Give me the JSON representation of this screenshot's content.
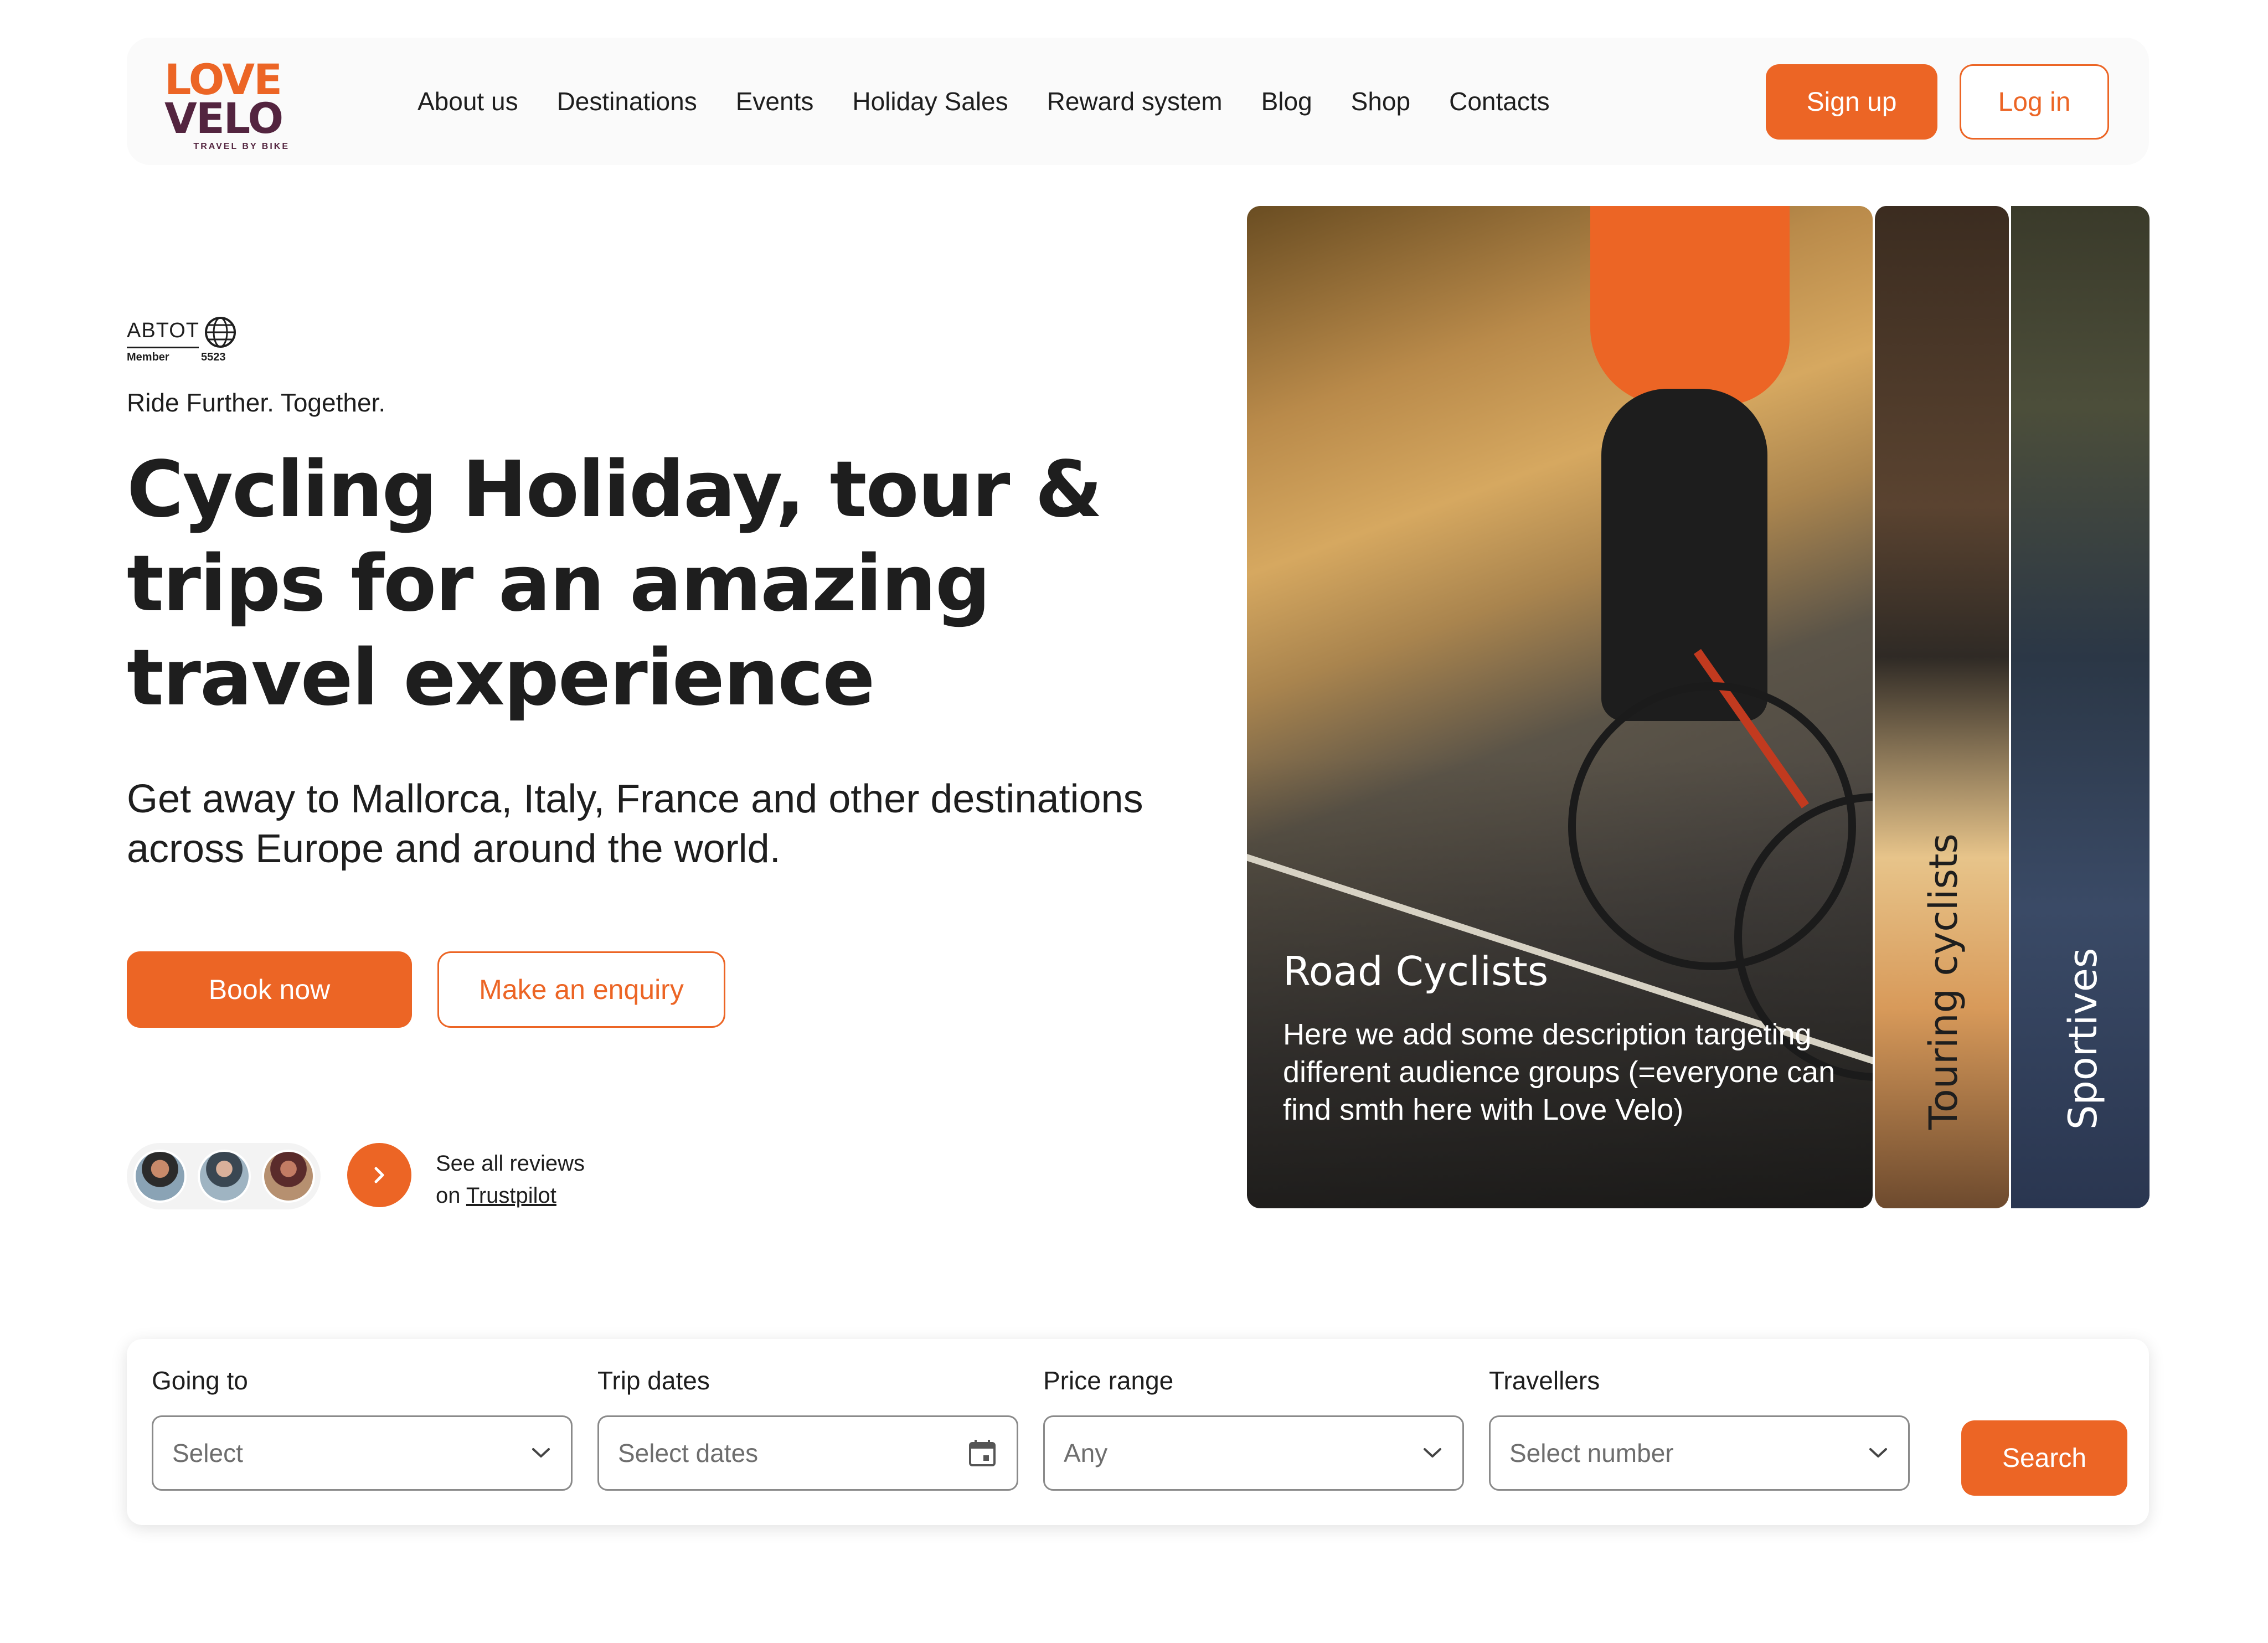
{
  "brand": {
    "logo_word1": "LOVE",
    "logo_word2": "VELO",
    "logo_tagline": "TRAVEL BY BIKE",
    "accent_color": "#ec6525",
    "brand_dark": "#53243f"
  },
  "nav": {
    "items": [
      "About us",
      "Destinations",
      "Events",
      "Holiday Sales",
      "Reward system",
      "Blog",
      "Shop",
      "Contacts"
    ],
    "signup_label": "Sign up",
    "login_label": "Log in"
  },
  "hero": {
    "badge": {
      "name": "ABTOT",
      "member_label": "Member",
      "member_number": "5523"
    },
    "tagline": "Ride Further. Together.",
    "title": "Cycling Holiday, tour & trips for an amazing travel experience",
    "subtitle": "Get away to Mallorca, Italy, France and other destinations across Europe and around the world.",
    "book_label": "Book now",
    "enquiry_label": "Make an enquiry",
    "reviews_line1": "See all reviews",
    "reviews_on": "on ",
    "reviews_link": "Trustpilot"
  },
  "cards": {
    "main_title": "Road Cyclists",
    "main_desc": "Here we add some description targeting different audience groups (=everyone can find smth here with Love Velo)",
    "touring_label": "Touring cyclists",
    "sportives_label": "Sportives"
  },
  "search": {
    "going_to": {
      "label": "Going to",
      "placeholder": "Select"
    },
    "trip_dates": {
      "label": "Trip dates",
      "placeholder": "Select dates"
    },
    "price_range": {
      "label": "Price range",
      "value": "Any"
    },
    "travellers": {
      "label": "Travellers",
      "placeholder": "Select number"
    },
    "button_label": "Search"
  }
}
